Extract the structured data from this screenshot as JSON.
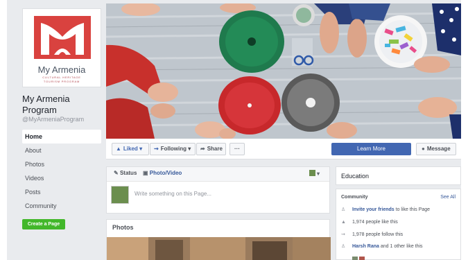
{
  "page": {
    "logo": {
      "name": "My Armenia",
      "subtitle_line1": "CULTURAL HERITAGE",
      "subtitle_line2": "TOURISM PROGRAM"
    },
    "title": "My Armenia Program",
    "handle": "@MyArmeniaProgram"
  },
  "nav": {
    "items": [
      {
        "label": "Home",
        "active": true
      },
      {
        "label": "About"
      },
      {
        "label": "Photos"
      },
      {
        "label": "Videos"
      },
      {
        "label": "Posts"
      },
      {
        "label": "Community"
      }
    ],
    "create_page": "Create a Page"
  },
  "actions": {
    "liked": "Liked",
    "following": "Following",
    "share": "Share",
    "more": "···",
    "learn_more": "Learn More",
    "message": "Message"
  },
  "composer": {
    "tab_status": "Status",
    "tab_photo": "Photo/Video",
    "placeholder": "Write something on this Page..."
  },
  "photos": {
    "title": "Photos"
  },
  "sidebar": {
    "education": "Education",
    "community": {
      "title": "Community",
      "see_all": "See All",
      "invite_link": "Invite your friends",
      "invite_suffix": " to like this Page",
      "likes": "1,974 people like this",
      "follows": "1,978 people follow this",
      "friend_link": "Harsh Rana",
      "friend_suffix": " and 1 other like this"
    }
  },
  "colors": {
    "brand": "#4267b2",
    "create_green": "#42b72a",
    "logo_red": "#d9423f",
    "link": "#365899"
  },
  "icons": [
    "thumbs-up-icon",
    "rss-icon",
    "share-arrow-icon",
    "messenger-icon",
    "pencil-icon",
    "photo-icon",
    "people-icon",
    "chevron-down-icon"
  ]
}
